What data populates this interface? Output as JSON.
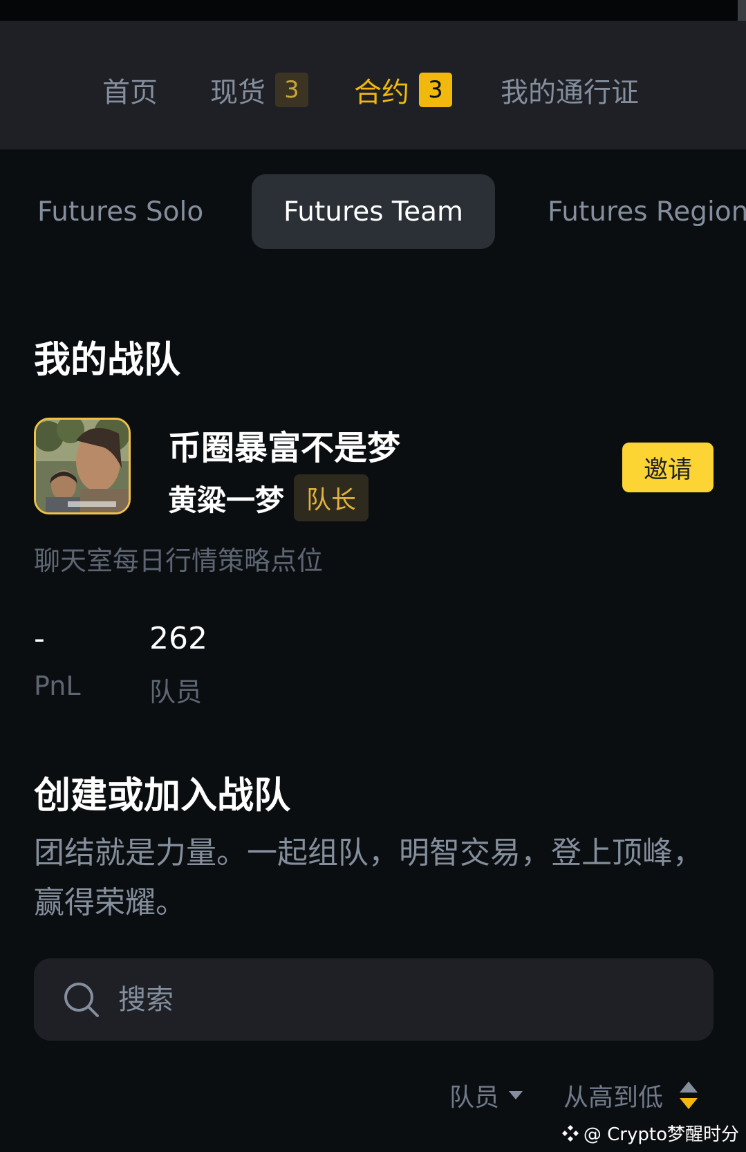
{
  "nav": {
    "items": [
      {
        "label": "首页"
      },
      {
        "label": "现货",
        "badge": "3"
      },
      {
        "label": "合约",
        "badge": "3"
      },
      {
        "label": "我的通行证"
      }
    ]
  },
  "tabs": [
    "Futures Solo",
    "Futures Team",
    "Futures Region"
  ],
  "my_team": {
    "heading": "我的战队",
    "name": "币圈暴富不是梦",
    "captain_name": "黄粱一梦",
    "role_badge": "队长",
    "invite_label": "邀请",
    "description": "聊天室每日行情策略点位",
    "pnl_value": "-",
    "pnl_label": "PnL",
    "members_value": "262",
    "members_label": "队员"
  },
  "create": {
    "heading": "创建或加入战队",
    "text": "团结就是力量。一起组队，明智交易，登上顶峰，赢得荣耀。"
  },
  "search": {
    "placeholder": "搜索"
  },
  "sort": {
    "field_label": "队员",
    "order_label": "从高到低"
  },
  "watermark": "@ Crypto梦醒时分",
  "colors": {
    "accent": "#f0b90b",
    "background": "#0b0e11",
    "panel": "#1e2026"
  }
}
